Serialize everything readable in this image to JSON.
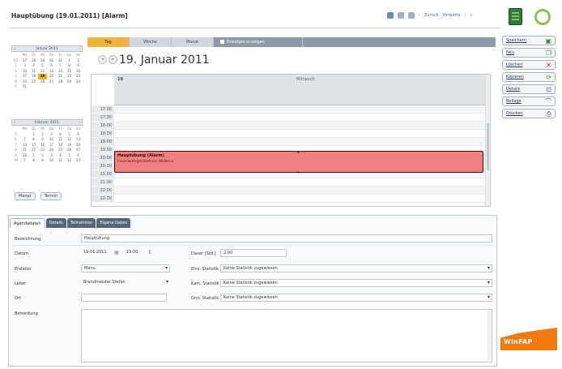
{
  "window": {
    "title": "Hauptübung (19.01.2011) [Alarm]"
  },
  "top_nav": {
    "zurueck_label": "Zurück",
    "vorwaerts_label": "Vorwärts"
  },
  "mini_calendars": [
    {
      "month": "Januar 2011",
      "dow": [
        "",
        "Mo",
        "Di",
        "Mi",
        "Do",
        "Fr",
        "Sa",
        "So"
      ],
      "weeks": [
        [
          "52",
          "27",
          "28",
          "29",
          "30",
          "31",
          "1",
          "2"
        ],
        [
          "1",
          "3",
          "4",
          "5",
          "6",
          "7",
          "8",
          "9"
        ],
        [
          "2",
          "10",
          "11",
          "12",
          "13",
          "14",
          "15",
          "16"
        ],
        [
          "3",
          "17",
          "18",
          "19",
          "20",
          "21",
          "22",
          "23"
        ],
        [
          "4",
          "24",
          "25",
          "26",
          "27",
          "28",
          "29",
          "30"
        ],
        [
          "5",
          "31",
          "",
          "",
          "",
          "",
          "",
          ""
        ]
      ],
      "selected": "19"
    },
    {
      "month": "Februar 2011",
      "dow": [
        "",
        "Mo",
        "Di",
        "Mi",
        "Do",
        "Fr",
        "Sa",
        "So"
      ],
      "weeks": [
        [
          "5",
          "",
          "1",
          "2",
          "3",
          "4",
          "5",
          "6"
        ],
        [
          "6",
          "7",
          "8",
          "9",
          "10",
          "11",
          "12",
          "13"
        ],
        [
          "7",
          "14",
          "15",
          "16",
          "17",
          "18",
          "19",
          "20"
        ],
        [
          "8",
          "21",
          "22",
          "23",
          "24",
          "25",
          "26",
          "27"
        ],
        [
          "9",
          "28",
          "1",
          "2",
          "3",
          "4",
          "5",
          "6"
        ],
        [
          "10",
          "7",
          "8",
          "9",
          "10",
          "11",
          "12",
          "13"
        ]
      ],
      "selected": ""
    }
  ],
  "mini_buttons": {
    "monat": "Monat",
    "termin": "Termin"
  },
  "view_tabs": {
    "tag": "Tag",
    "woche": "Woche",
    "monat": "Monat",
    "erledigte": "Erledigte anzeigen"
  },
  "calendar": {
    "date_title": "19. Januar 2011",
    "day_number": "19",
    "day_of_week": "Mittwoch",
    "times": [
      "17:00",
      "17:30",
      "18:00",
      "18:30",
      "19:00",
      "19:30",
      "20:00",
      "20:30",
      "21:00",
      "21:30",
      "22:00",
      "22:30"
    ],
    "event": {
      "title": "Hauptübung (Alarm)",
      "subtitle": "Feuerwehrgerätehaus Wattens"
    }
  },
  "actions": [
    {
      "label": "Speichern",
      "icon": "save-icon",
      "glyph": "▣",
      "color": "#2e8b2e"
    },
    {
      "label": "Neu",
      "icon": "new-icon",
      "glyph": "❐",
      "color": "#2e8b2e"
    },
    {
      "label": "Löschen",
      "icon": "delete-icon",
      "glyph": "✕",
      "color": "#d0201a"
    },
    {
      "label": "Kopieren",
      "icon": "copy-icon",
      "glyph": "⟳",
      "color": "#3a9a2a"
    },
    {
      "label": "Details",
      "icon": "details-icon",
      "glyph": "⊡",
      "color": "#3a5a9a"
    },
    {
      "label": "Beilage",
      "icon": "attach-icon",
      "glyph": "⌒",
      "color": "#555555"
    },
    {
      "label": "Drucken",
      "icon": "print-icon",
      "glyph": "⎙",
      "color": "#555555"
    }
  ],
  "panel_tabs": [
    "Agendadaten",
    "Details",
    "Teilnehmer",
    "Eigene Daten"
  ],
  "form": {
    "bezeichnung_label": "Bezeichnung",
    "bezeichnung_value": "Hauptübung",
    "datum_label": "Datum",
    "datum_value": "19.01.2011",
    "zeit_value": "19:00",
    "dauer_label": "Dauer [Std.]",
    "dauer_value": "2,00",
    "ersteller_label": "Ersteller",
    "ersteller_value": "Manu",
    "leiter_label": "Leiter",
    "leiter_value": "Brandmeister Stefan",
    "ort_label": "Ort",
    "ort_value": "",
    "stat1_label": "Einz. Statistik",
    "stat1_value": "Keine Statistik zugewiesen",
    "stat2_label": "Kam. Statistik",
    "stat2_value": "Keine Statistik zugewiesen",
    "stat3_label": "Grm. Statistik",
    "stat3_value": "Keine Statistik zugewiesen",
    "bemerkung_label": "Bemerkung"
  },
  "logo": {
    "text": "WinFAP"
  }
}
